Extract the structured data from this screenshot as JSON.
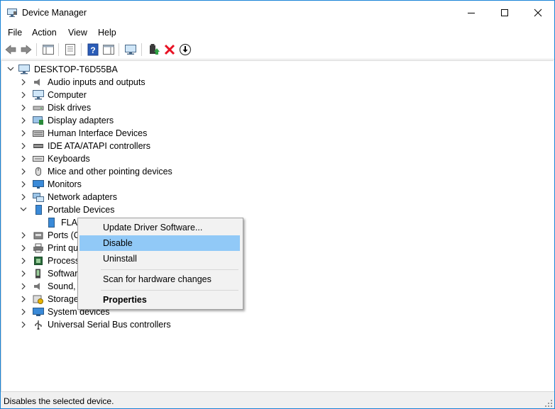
{
  "window": {
    "title": "Device Manager"
  },
  "menu": [
    "File",
    "Action",
    "View",
    "Help"
  ],
  "tree": {
    "root": "DESKTOP-T6D55BA",
    "categories": [
      "Audio inputs and outputs",
      "Computer",
      "Disk drives",
      "Display adapters",
      "Human Interface Devices",
      "IDE ATA/ATAPI controllers",
      "Keyboards",
      "Mice and other pointing devices",
      "Monitors",
      "Network adapters",
      "Portable Devices",
      "Ports (C",
      "Print qu",
      "Processo",
      "Software",
      "Sound, v",
      "Storage",
      "System devices",
      "Universal Serial Bus controllers"
    ],
    "portable_child": "FLAS"
  },
  "context_menu": {
    "update": "Update Driver Software...",
    "disable": "Disable",
    "uninstall": "Uninstall",
    "scan": "Scan for hardware changes",
    "properties": "Properties"
  },
  "status": "Disables the selected device.",
  "colors": {
    "highlight": "#91c9f7",
    "accent": "#1883d7",
    "delete_x": "#e81123"
  }
}
